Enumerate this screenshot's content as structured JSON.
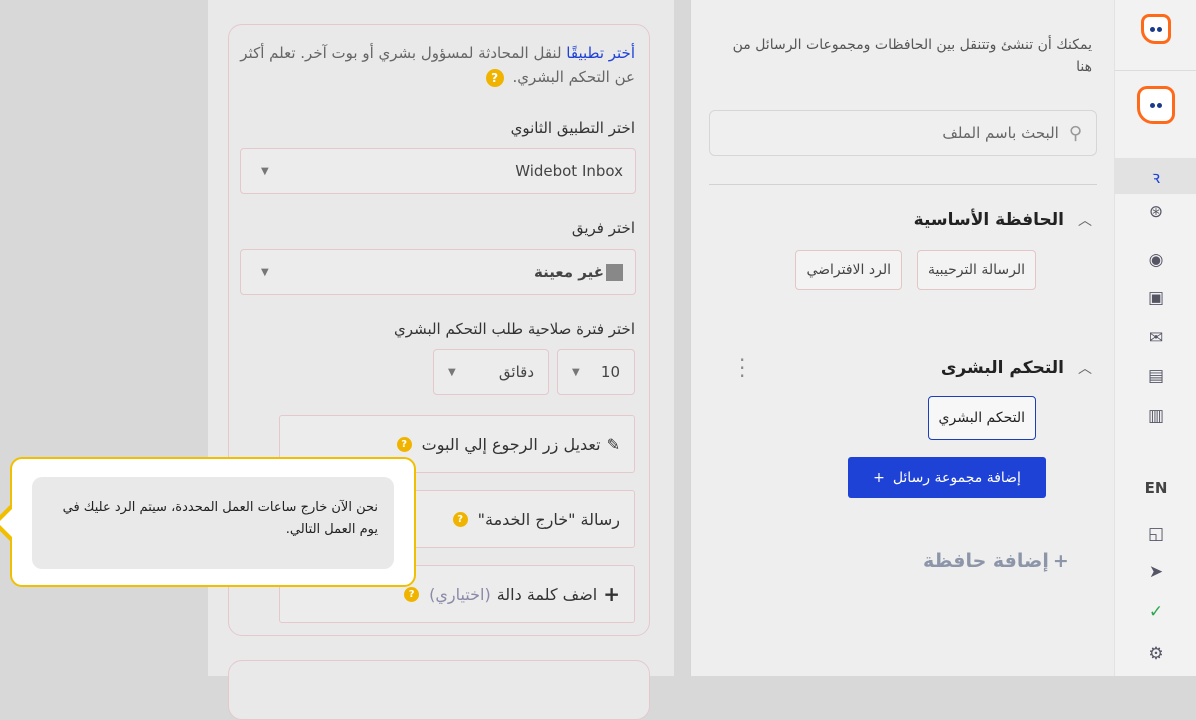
{
  "rail": {
    "language": "EN",
    "icons": [
      "brand-logo-icon",
      "flow-icon",
      "brain-icon",
      "broadcast-icon",
      "contacts-icon",
      "mail-icon",
      "segments-icon",
      "analytics-icon",
      "wallet-icon",
      "send-icon",
      "check-icon",
      "settings-icon"
    ]
  },
  "sidebar": {
    "help_text": "يمكنك أن تنشئ وتتنقل بين الحافظات ومجموعات الرسائل من هنا",
    "search_placeholder": "البحث باسم الملف",
    "folders": [
      {
        "title": "الحافظة الأساسية",
        "items": [
          "الرسالة الترحيبية",
          "الرد الافتراضي"
        ]
      },
      {
        "title": "التحكم البشرى",
        "items": [
          "التحكم البشري"
        ]
      }
    ],
    "add_group_label": "إضافة مجموعة رسائل",
    "add_group_plus": "+",
    "add_folder_label": "إضافة حافظة",
    "add_folder_plus": "+"
  },
  "card": {
    "intro_link": "أختر تطبيقًا",
    "intro_text": " لنقل المحادثة لمسؤول بشري أو بوت آخر. تعلم أكثر عن التحكم البشري.",
    "secondary_app_label": "اختر التطبيق الثانوي",
    "secondary_app_value": "Widebot Inbox",
    "team_label": "اختر فريق",
    "team_value": "غير معينة",
    "validity_label": "اختر فترة صلاحية طلب التحكم البشري",
    "validity_number": "10",
    "validity_unit": "دقائق",
    "edit_back_label": "تعديل زر الرجوع إلي البوت",
    "out_of_service_label": "رسالة \"خارج الخدمة\"",
    "add_keyword_label": "اضف كلمة دالة",
    "add_keyword_optional": "(اختياري)"
  },
  "tooltip": {
    "text": "نحن الآن خارج ساعات العمل المحددة، سيتم الرد عليك في يوم العمل التالي."
  }
}
